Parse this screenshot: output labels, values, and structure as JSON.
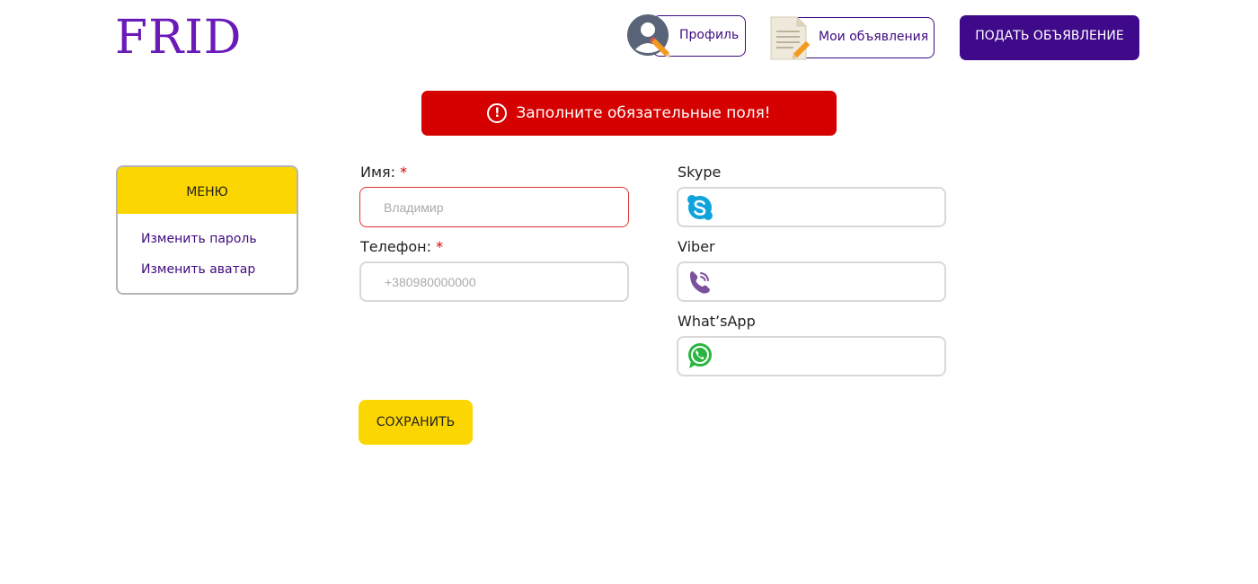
{
  "header": {
    "logo": "FRID",
    "profile_label": "Профиль",
    "my_ads_label": "Мои объявления",
    "post_ad_label": "ПОДАТЬ ОБЪЯВЛЕНИЕ"
  },
  "alert": {
    "message": "Заполните обязательные поля!",
    "icon": "!",
    "color": "#d50000"
  },
  "menu": {
    "title": "МЕНЮ",
    "items": [
      {
        "label": "Изменить пароль"
      },
      {
        "label": "Изменить аватар"
      }
    ]
  },
  "form": {
    "name": {
      "label": "Имя:",
      "required_mark": "*",
      "placeholder": "Владимир",
      "value": ""
    },
    "phone": {
      "label": "Телефон:",
      "required_mark": "*",
      "placeholder": "+380980000000",
      "value": ""
    },
    "skype": {
      "label": "Skype",
      "value": ""
    },
    "viber": {
      "label": "Viber",
      "value": ""
    },
    "whatsapp": {
      "label": "What’sApp",
      "value": ""
    },
    "save_label": "СОХРАНИТЬ"
  },
  "colors": {
    "brand_purple": "#3f0a8a",
    "logo_purple": "#6a1ab8",
    "accent_yellow": "#fbd600",
    "error_red": "#d50000"
  }
}
